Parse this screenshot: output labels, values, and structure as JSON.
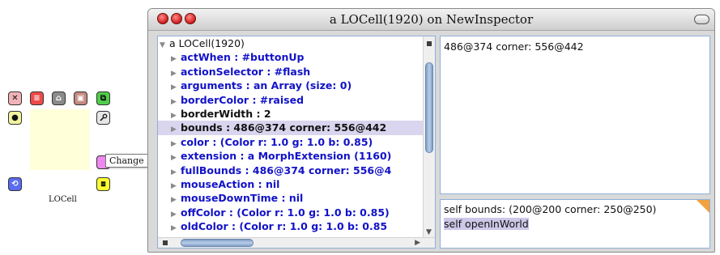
{
  "morph": {
    "label": "LOCell",
    "color": "#ffffd9"
  },
  "tooltip": {
    "text": "Change size"
  },
  "halo": {
    "handles": [
      {
        "name": "delete",
        "icon": "close-icon",
        "color": "#f2b3b8",
        "glyph": "✕"
      },
      {
        "name": "menu",
        "icon": "menu-icon",
        "color": "#ef4b4b",
        "glyph": "≡"
      },
      {
        "name": "pick-up",
        "icon": "grab-icon",
        "color": "#8b8b8b",
        "glyph": "⌂"
      },
      {
        "name": "move",
        "icon": "move-icon",
        "color": "#c4897e",
        "glyph": "▣"
      },
      {
        "name": "duplicate",
        "icon": "duplicate-icon",
        "color": "#4fcf4a",
        "glyph": "⧉"
      },
      {
        "name": "debug",
        "icon": "debug-icon",
        "color": "#f3f3a0",
        "glyph": "●"
      },
      {
        "name": "inspect",
        "icon": "wrench-icon",
        "color": "#e7e7e7",
        "glyph": "🔧"
      },
      {
        "name": "rotate",
        "icon": "rotate-icon",
        "color": "#5b6cf0",
        "glyph": "⟲"
      },
      {
        "name": "color",
        "icon": "color-icon",
        "color": "#ee88ee",
        "glyph": ""
      },
      {
        "name": "resize",
        "icon": "resize-icon",
        "color": "#ffff2e",
        "glyph": "⧈"
      }
    ]
  },
  "window": {
    "title": "a LOCell(1920) on NewInspector",
    "colors": {
      "close": "#d21b1b",
      "selection": "#d9d5ee",
      "field_text": "#1212c8",
      "corner": "#f2a23c"
    }
  },
  "tree": {
    "root": "a LOCell(1920)",
    "fields": [
      "actWhen : #buttonUp",
      "actionSelector : #flash",
      "arguments : an Array (size: 0)",
      "borderColor : #raised",
      "borderWidth : 2",
      "bounds : 486@374 corner: 556@442",
      "color : (Color r: 1.0 g: 1.0 b: 0.85)",
      "extension : a MorphExtension (1160)",
      "fullBounds : 486@374 corner: 556@4",
      "mouseAction : nil",
      "mouseDownTime : nil",
      "offColor : (Color r: 1.0 g: 1.0 b: 0.85)",
      "oldColor : (Color r: 1.0 g: 1.0 b: 0.85"
    ],
    "selected_index": 5
  },
  "value_pane": {
    "text": "486@374 corner: 556@442"
  },
  "code_pane": {
    "line1": "self bounds: (200@200 corner: 250@250)",
    "line2": "self openInWorld"
  }
}
